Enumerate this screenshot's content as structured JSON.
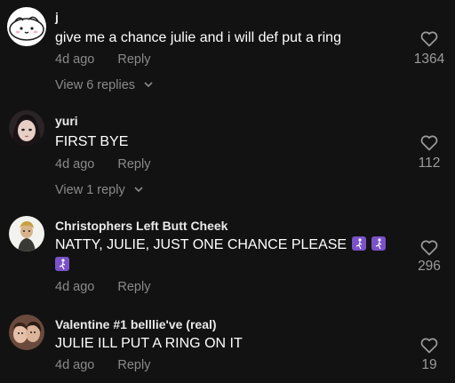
{
  "comments": [
    {
      "username": "j",
      "text": "give me a chance julie and i will def put a ring",
      "time": "4d ago",
      "reply_label": "Reply",
      "view_replies": "View 6 replies",
      "likes": "1364",
      "avatar_icon": "cartoon-face-avatar"
    },
    {
      "username": "yuri",
      "text": "FIRST BYE",
      "time": "4d ago",
      "reply_label": "Reply",
      "view_replies": "View 1 reply",
      "likes": "112",
      "avatar_icon": "photo-avatar"
    },
    {
      "username": "Christophers Left Butt Cheek",
      "text": "NATTY, JULIE, JUST ONE CHANCE PLEASE",
      "time": "4d ago",
      "reply_label": "Reply",
      "likes": "296",
      "avatar_icon": "photo-avatar",
      "emoji_icon": "pleading-person-emoji"
    },
    {
      "username": "Valentine #1 belllie've (real)",
      "text": "JULIE ILL PUT A RING ON IT",
      "time": "4d ago",
      "reply_label": "Reply",
      "likes": "19",
      "avatar_icon": "photo-avatar"
    }
  ],
  "colors": {
    "background": "#121212",
    "text": "#ffffff",
    "muted": "#8a8a8a",
    "emoji": "#7a52c8"
  }
}
